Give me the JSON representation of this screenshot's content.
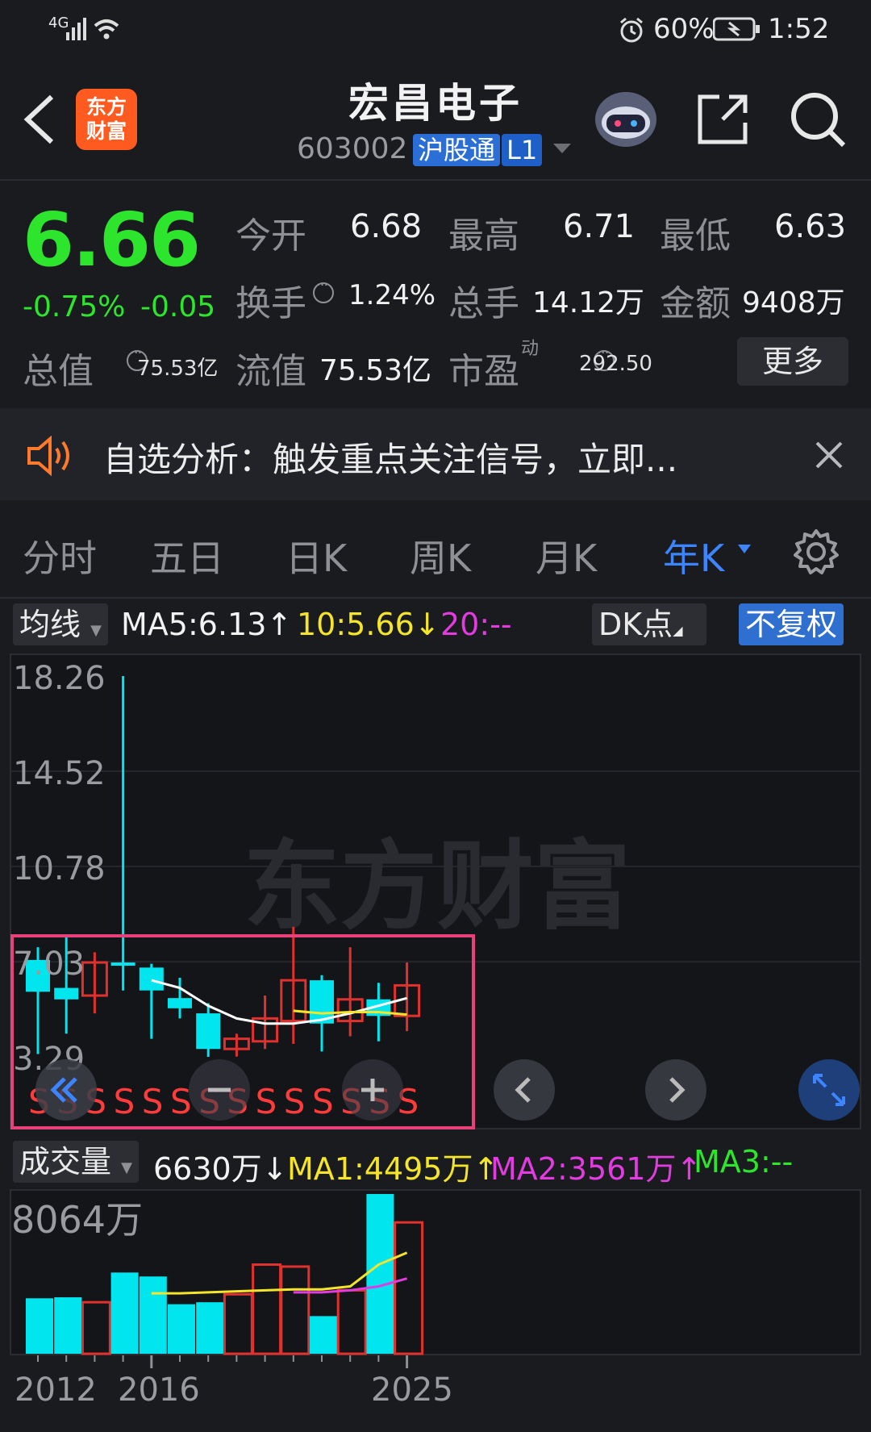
{
  "status": {
    "network": "4G",
    "battery": "60%",
    "time": "1:52"
  },
  "header": {
    "title": "宏昌电子",
    "code": "603002",
    "tag1": "沪股通",
    "tag2": "L1",
    "logo_line1": "东方",
    "logo_line2": "财富"
  },
  "quote": {
    "price": "6.66",
    "change_pct": "-0.75%",
    "change_abs": "-0.05",
    "open_label": "今开",
    "open": "6.68",
    "high_label": "最高",
    "high": "6.71",
    "low_label": "最低",
    "low": "6.63",
    "turnover_label": "换手",
    "turnover": "1.24%",
    "volume_label": "总手",
    "volume": "14.12万",
    "amount_label": "金额",
    "amount": "9408万",
    "mktcap_label": "总值",
    "mktcap": "75.53亿",
    "float_label": "流值",
    "float": "75.53亿",
    "pe_label": "市盈",
    "pe_sup": "动",
    "pe": "292.50",
    "more": "更多"
  },
  "notice": {
    "text": "自选分析：触发重点关注信号，立即...",
    "close": "×"
  },
  "tabs": [
    "分时",
    "五日",
    "日K",
    "周K",
    "月K",
    "年K"
  ],
  "active_tab": "年K",
  "ma": {
    "selector": "均线",
    "ma5": "MA5:6.13↑",
    "ma10": "10:5.66↓",
    "ma20": "20:--",
    "dk": "DK点",
    "fq": "不复权"
  },
  "price_axis": [
    "18.26",
    "14.52",
    "10.78",
    "7.03",
    "3.29"
  ],
  "watermark": "东方财富",
  "vol": {
    "selector": "成交量",
    "value": "6630万↓",
    "ma1": "MA1:4495万↑",
    "ma2": "MA2:3561万↑",
    "ma3": "MA3:--",
    "max": "8064万"
  },
  "x_axis": [
    "2012",
    "2016",
    "2025"
  ],
  "signal_letter": "S",
  "colors": {
    "up": "#e0312e",
    "down": "#00e5ee",
    "ma5": "#ffffff",
    "ma10": "#f5e52a",
    "ma20": "#e23be0",
    "highlight": "#e8417a"
  },
  "chart_data": {
    "type": "candlestick",
    "note_years_axis": "yearly candles",
    "candles": [
      {
        "o": 7.1,
        "c": 5.85,
        "h": 7.6,
        "l": 3.4
      },
      {
        "o": 6.0,
        "c": 5.55,
        "h": 8.0,
        "l": 4.2
      },
      {
        "o": 5.7,
        "c": 7.0,
        "h": 7.4,
        "l": 5.0
      },
      {
        "o": 7.0,
        "c": 6.9,
        "h": 18.26,
        "l": 5.9
      },
      {
        "o": 6.8,
        "c": 5.9,
        "h": 6.95,
        "l": 4.0
      },
      {
        "o": 5.6,
        "c": 5.2,
        "h": 6.4,
        "l": 4.8
      },
      {
        "o": 5.0,
        "c": 3.6,
        "h": 5.4,
        "l": 3.29
      },
      {
        "o": 3.6,
        "c": 4.0,
        "h": 4.2,
        "l": 3.3
      },
      {
        "o": 3.9,
        "c": 4.8,
        "h": 5.7,
        "l": 3.6
      },
      {
        "o": 4.7,
        "c": 6.3,
        "h": 8.4,
        "l": 3.8
      },
      {
        "o": 6.3,
        "c": 4.6,
        "h": 6.5,
        "l": 3.5
      },
      {
        "o": 4.7,
        "c": 5.55,
        "h": 7.6,
        "l": 4.1
      },
      {
        "o": 5.55,
        "c": 4.9,
        "h": 6.2,
        "l": 3.9
      },
      {
        "o": 4.9,
        "c": 6.1,
        "h": 7.0,
        "l": 4.3
      }
    ],
    "ma5": [
      null,
      null,
      null,
      null,
      6.3,
      6.0,
      5.3,
      4.8,
      4.6,
      4.6,
      4.75,
      5.0,
      5.3,
      5.6
    ],
    "ma10": [
      null,
      null,
      null,
      null,
      null,
      null,
      null,
      null,
      null,
      5.1,
      5.0,
      5.05,
      5.05,
      4.95
    ],
    "volume": [
      2800,
      2850,
      2600,
      4100,
      3900,
      2500,
      2600,
      3000,
      4500,
      4400,
      1900,
      3200,
      8064,
      6630
    ],
    "volume_up": [
      false,
      false,
      true,
      false,
      false,
      false,
      false,
      true,
      true,
      true,
      false,
      true,
      false,
      true
    ],
    "vol_ma1": [
      null,
      null,
      null,
      null,
      3050,
      3050,
      3100,
      3150,
      3200,
      3250,
      3250,
      3400,
      4500,
      5100
    ],
    "vol_ma2": [
      null,
      null,
      null,
      null,
      null,
      null,
      null,
      null,
      null,
      3100,
      3100,
      3200,
      3400,
      3800
    ],
    "ylim": [
      3.29,
      18.26
    ],
    "vol_ylim": [
      0,
      8064
    ]
  }
}
